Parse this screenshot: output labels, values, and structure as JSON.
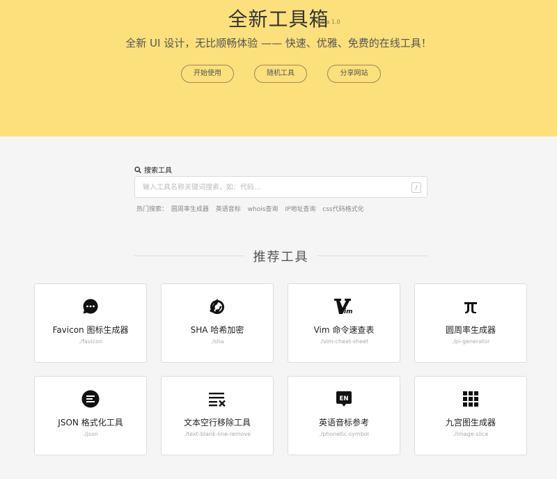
{
  "hero": {
    "title": "全新工具箱",
    "version": "Beta 1.0",
    "subtitle": "全新 UI 设计，无比顺畅体验 —— 快速、优雅、免费的在线工具！",
    "buttons": [
      "开始使用",
      "随机工具",
      "分享网站"
    ],
    "background_color": "#fbe07c"
  },
  "search": {
    "label": "搜索工具",
    "placeholder": "输入工具名称关键词搜索，如：代码...",
    "shortcut": "/",
    "hot_label": "热门搜索：",
    "hot_tags": [
      "圆周率生成器",
      "英语音标",
      "whois查询",
      "IP地址查询",
      "css代码格式化"
    ]
  },
  "section": {
    "title": "推荐工具"
  },
  "tools": [
    {
      "name": "Favicon 图标生成器",
      "path": "./favicon",
      "icon": "chat-bubble-icon"
    },
    {
      "name": "SHA 哈希加密",
      "path": "./sha",
      "icon": "sha-logo-icon"
    },
    {
      "name": "Vim 命令速查表",
      "path": "./vim-cheat-sheet",
      "icon": "vim-logo-icon"
    },
    {
      "name": "圆周率生成器",
      "path": "./pi-generator",
      "icon": "pi-icon"
    },
    {
      "name": "JSON 格式化工具",
      "path": "./json",
      "icon": "align-lines-icon"
    },
    {
      "name": "文本空行移除工具",
      "path": "./text-blank-line-remove",
      "icon": "clear-format-icon"
    },
    {
      "name": "英语音标参考",
      "path": "./phonetic-symbol",
      "icon": "en-bubble-icon"
    },
    {
      "name": "九宫图生成器",
      "path": "./image-slice",
      "icon": "grid-icon"
    }
  ]
}
